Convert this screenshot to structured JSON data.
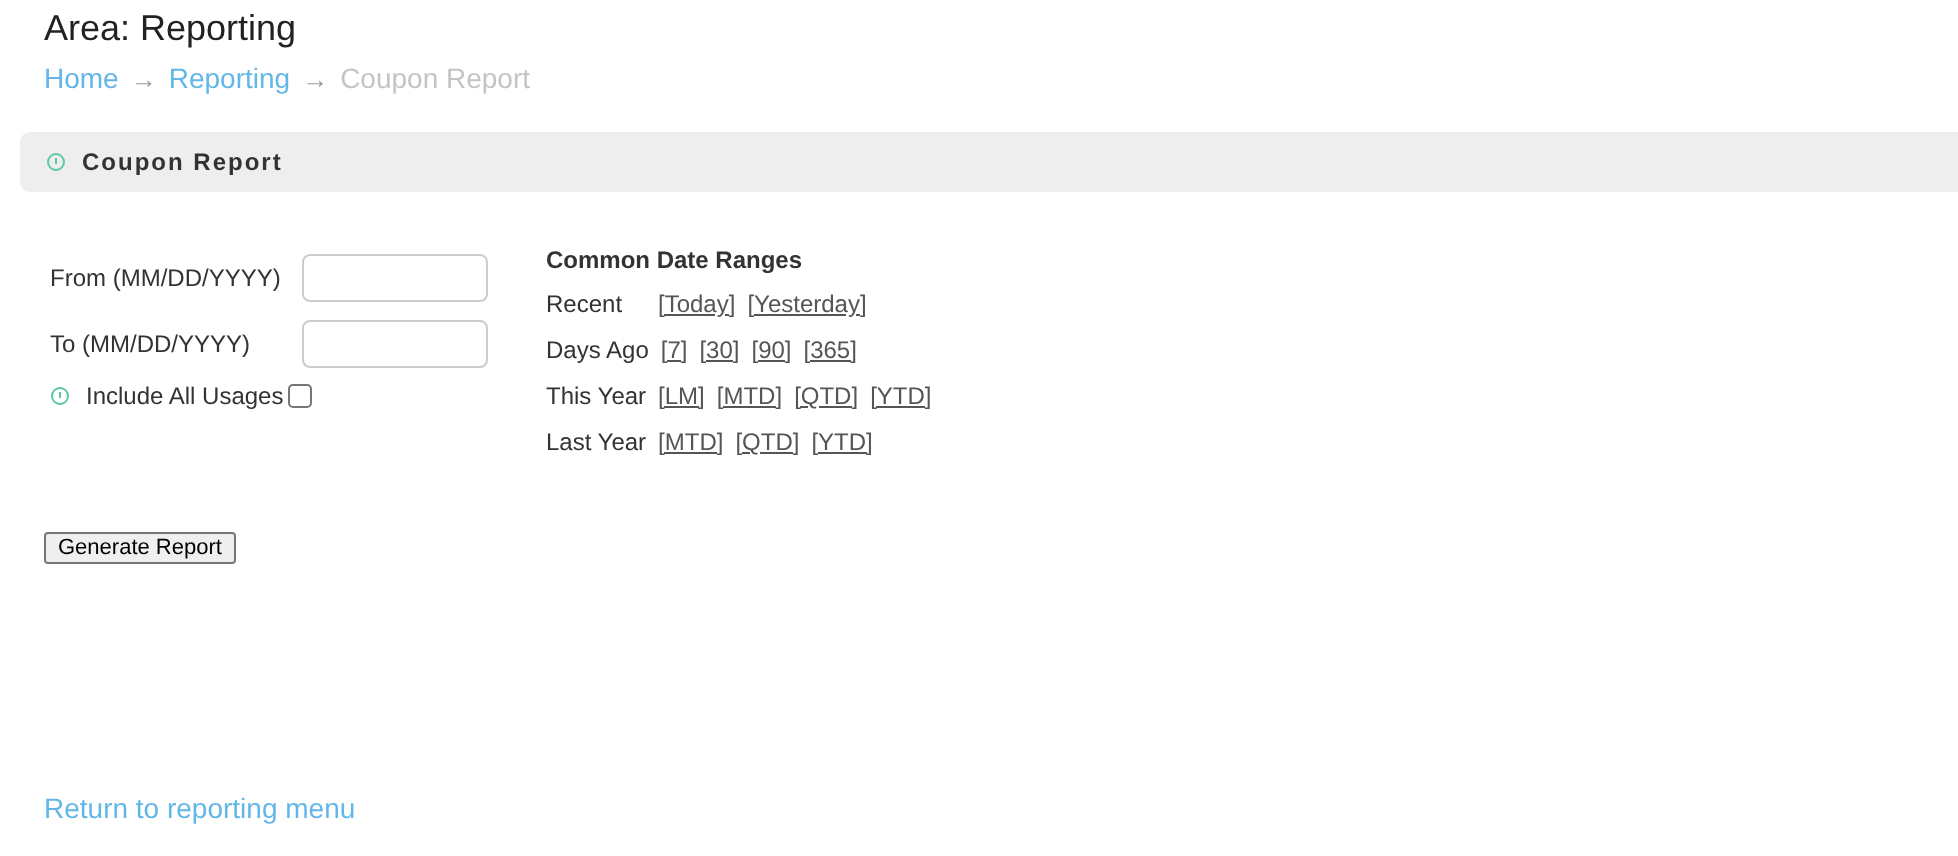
{
  "page_title": "Area: Reporting",
  "breadcrumb": [
    {
      "label": "Home",
      "current": false
    },
    {
      "label": "Reporting",
      "current": false
    },
    {
      "label": "Coupon Report",
      "current": true
    }
  ],
  "breadcrumb_separator": "→",
  "panel": {
    "title": "Coupon Report"
  },
  "fields": [
    {
      "label": "From (MM/DD/YYYY)"
    },
    {
      "label": "To (MM/DD/YYYY)"
    }
  ],
  "include_all": {
    "label": "Include All Usages",
    "checked": false
  },
  "date_ranges": {
    "title": "Common Date Ranges",
    "rows": [
      {
        "label": "Recent",
        "links": [
          "[Today]",
          "[Yesterday]"
        ]
      },
      {
        "label": "Days Ago",
        "links": [
          "[7]",
          "[30]",
          "[90]",
          "[365]"
        ]
      },
      {
        "label": "This Year",
        "links": [
          "[LM]",
          "[MTD]",
          "[QTD]",
          "[YTD]"
        ]
      },
      {
        "label": "Last Year",
        "links": [
          "[MTD]",
          "[QTD]",
          "[YTD]"
        ]
      }
    ]
  },
  "button": "Generate Report",
  "footer_link": "Return to reporting menu"
}
